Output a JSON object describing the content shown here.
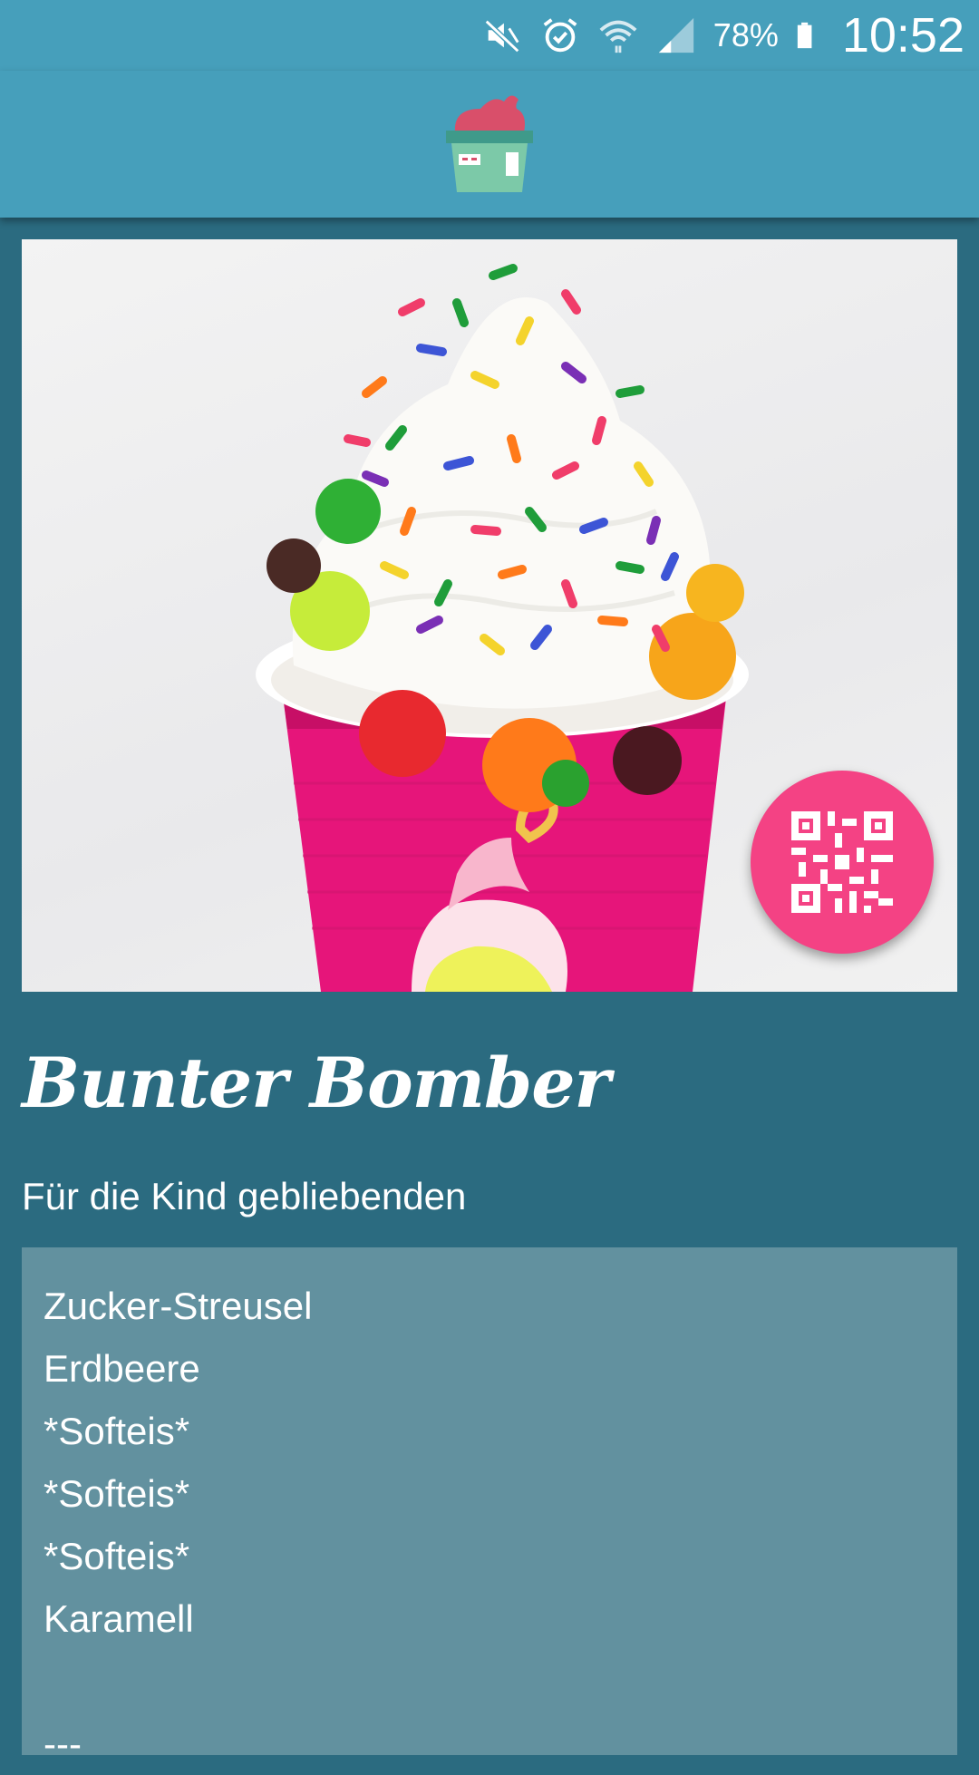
{
  "status_bar": {
    "battery_percent": "78%",
    "time": "10:52",
    "icons": [
      "mute-icon",
      "alarm-icon",
      "wifi-icon",
      "signal-icon",
      "battery-icon"
    ]
  },
  "toolbar": {
    "logo_icon": "frozen-yogurt-shop-icon"
  },
  "product": {
    "name": "Bunter Bomber",
    "tagline": "Für die Kind gebliebenden",
    "ingredients": [
      "Zucker-Streusel",
      "Erdbeere",
      "*Softeis*",
      "*Softeis*",
      "*Softeis*",
      "Karamell"
    ],
    "more_indicator": "---"
  },
  "fab": {
    "icon": "qr-code-icon"
  },
  "colors": {
    "status_bar": "#469fbb",
    "toolbar": "#469fbb",
    "background": "#2b6b80",
    "ingredients_box": "#62919f",
    "fab": "#f44284"
  }
}
